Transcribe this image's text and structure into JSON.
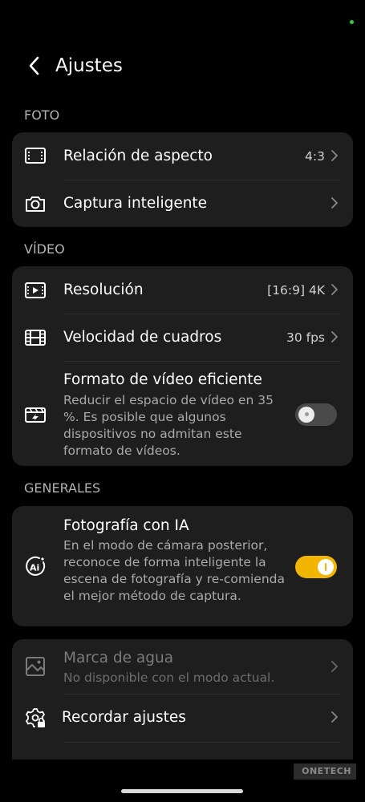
{
  "header": {
    "title": "Ajustes"
  },
  "sections": {
    "foto": {
      "label": "FOTO",
      "aspect": {
        "title": "Relación de aspecto",
        "value": "4:3"
      },
      "smart": {
        "title": "Captura inteligente"
      }
    },
    "video": {
      "label": "VÍDEO",
      "resolution": {
        "title": "Resolución",
        "value": "[16:9] 4K"
      },
      "framerate": {
        "title": "Velocidad de cuadros",
        "value": "30 fps"
      },
      "efficient": {
        "title": "Formato de vídeo eficiente",
        "desc": "Reducir el espacio de vídeo en 35 %. Es posible que algunos dispositivos no admitan este formato de vídeos.",
        "enabled": false
      }
    },
    "generales": {
      "label": "GENERALES",
      "ai": {
        "title": "Fotografía con IA",
        "desc": "En el modo de cámara posterior, reconoce de forma inteligente la escena de fotografía y re-comienda el mejor método de captura.",
        "enabled": true
      },
      "watermark": {
        "title": "Marca de agua",
        "desc": "No disponible con el modo actual."
      },
      "remember": {
        "title": "Recordar ajustes"
      }
    }
  },
  "overlay": {
    "watermark_text": "ONETECH"
  },
  "colors": {
    "accent": "#f2b600",
    "card": "#1e1e1e",
    "background": "#000000",
    "status_dot": "#2ecc40"
  }
}
